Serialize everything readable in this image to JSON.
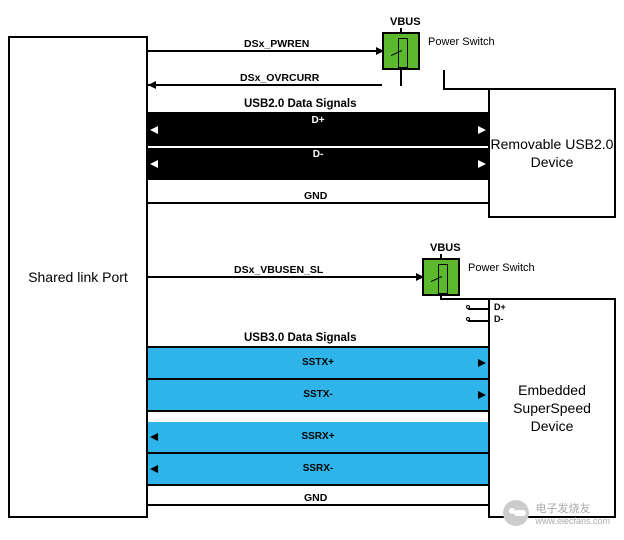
{
  "blocks": {
    "shared_port": "Shared link Port",
    "usb2_device": "Removable USB2.0\nDevice",
    "ss_device": "Embedded\nSuperSpeed Device"
  },
  "power_switches": {
    "vbus_label": "VBUS",
    "switch_label": "Power Switch"
  },
  "signals_usb2": {
    "pwren": "DSx_PWREN",
    "ovrcurr": "DSx_OVRCURR",
    "header": "USB2.0 Data Signals",
    "dp": "D+",
    "dm": "D-",
    "gnd": "GND"
  },
  "signals_usb3": {
    "vbusen": "DSx_VBUSEN_SL",
    "dp_stub": "D+",
    "dm_stub": "D-",
    "header": "USB3.0 Data Signals",
    "sstxp": "SSTX+",
    "sstxm": "SSTX-",
    "ssrxp": "SSRX+",
    "ssrxm": "SSRX-",
    "gnd": "GND"
  },
  "watermark": {
    "brand": "电子发烧友",
    "url": "www.elecfans.com"
  }
}
